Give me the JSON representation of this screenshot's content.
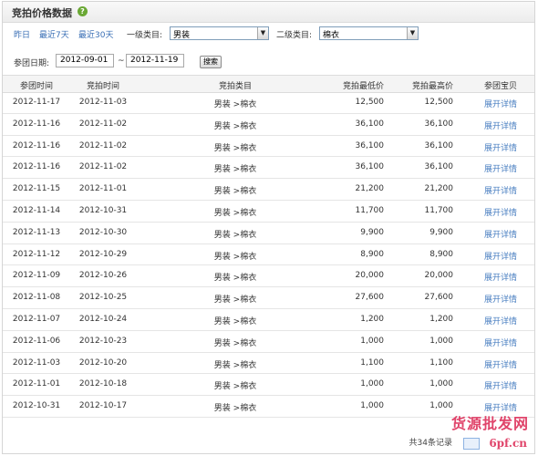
{
  "panel": {
    "title": "竞拍价格数据"
  },
  "filters": {
    "quick_ranges": [
      "昨日",
      "最近7天",
      "最近30天"
    ],
    "category1_label": "一级类目:",
    "category1_value": "男装",
    "category2_label": "二级类目:",
    "category2_value": "棉衣",
    "date_label": "参团日期:",
    "date_from": "2012-09-01",
    "date_sep": "~",
    "date_to": "2012-11-19",
    "search_label": "搜索"
  },
  "table": {
    "columns": [
      "参团时间",
      "竞拍时间",
      "竞拍类目",
      "竞拍最低价",
      "竞拍最高价",
      "参团宝贝"
    ],
    "rows": [
      [
        "2012-11-17",
        "2012-11-03",
        "男装 >棉衣",
        "12,500",
        "12,500",
        "展开详情"
      ],
      [
        "2012-11-16",
        "2012-11-02",
        "男装 >棉衣",
        "36,100",
        "36,100",
        "展开详情"
      ],
      [
        "2012-11-16",
        "2012-11-02",
        "男装 >棉衣",
        "36,100",
        "36,100",
        "展开详情"
      ],
      [
        "2012-11-16",
        "2012-11-02",
        "男装 >棉衣",
        "36,100",
        "36,100",
        "展开详情"
      ],
      [
        "2012-11-15",
        "2012-11-01",
        "男装 >棉衣",
        "21,200",
        "21,200",
        "展开详情"
      ],
      [
        "2012-11-14",
        "2012-10-31",
        "男装 >棉衣",
        "11,700",
        "11,700",
        "展开详情"
      ],
      [
        "2012-11-13",
        "2012-10-30",
        "男装 >棉衣",
        "9,900",
        "9,900",
        "展开详情"
      ],
      [
        "2012-11-12",
        "2012-10-29",
        "男装 >棉衣",
        "8,900",
        "8,900",
        "展开详情"
      ],
      [
        "2012-11-09",
        "2012-10-26",
        "男装 >棉衣",
        "20,000",
        "20,000",
        "展开详情"
      ],
      [
        "2012-11-08",
        "2012-10-25",
        "男装 >棉衣",
        "27,600",
        "27,600",
        "展开详情"
      ],
      [
        "2012-11-07",
        "2012-10-24",
        "男装 >棉衣",
        "1,200",
        "1,200",
        "展开详情"
      ],
      [
        "2012-11-06",
        "2012-10-23",
        "男装 >棉衣",
        "1,000",
        "1,000",
        "展开详情"
      ],
      [
        "2012-11-03",
        "2012-10-20",
        "男装 >棉衣",
        "1,100",
        "1,100",
        "展开详情"
      ],
      [
        "2012-11-01",
        "2012-10-18",
        "男装 >棉衣",
        "1,000",
        "1,000",
        "展开详情"
      ],
      [
        "2012-10-31",
        "2012-10-17",
        "男装 >棉衣",
        "1,000",
        "1,000",
        "展开详情"
      ]
    ]
  },
  "footer": {
    "total_text": "共34条记录"
  },
  "watermark": {
    "line1": "货源批发网",
    "line2": "6pf.cn"
  },
  "colors": {
    "link": "#3a6fb5",
    "help_icon": "#6aa834",
    "watermark": "#e0446a"
  }
}
